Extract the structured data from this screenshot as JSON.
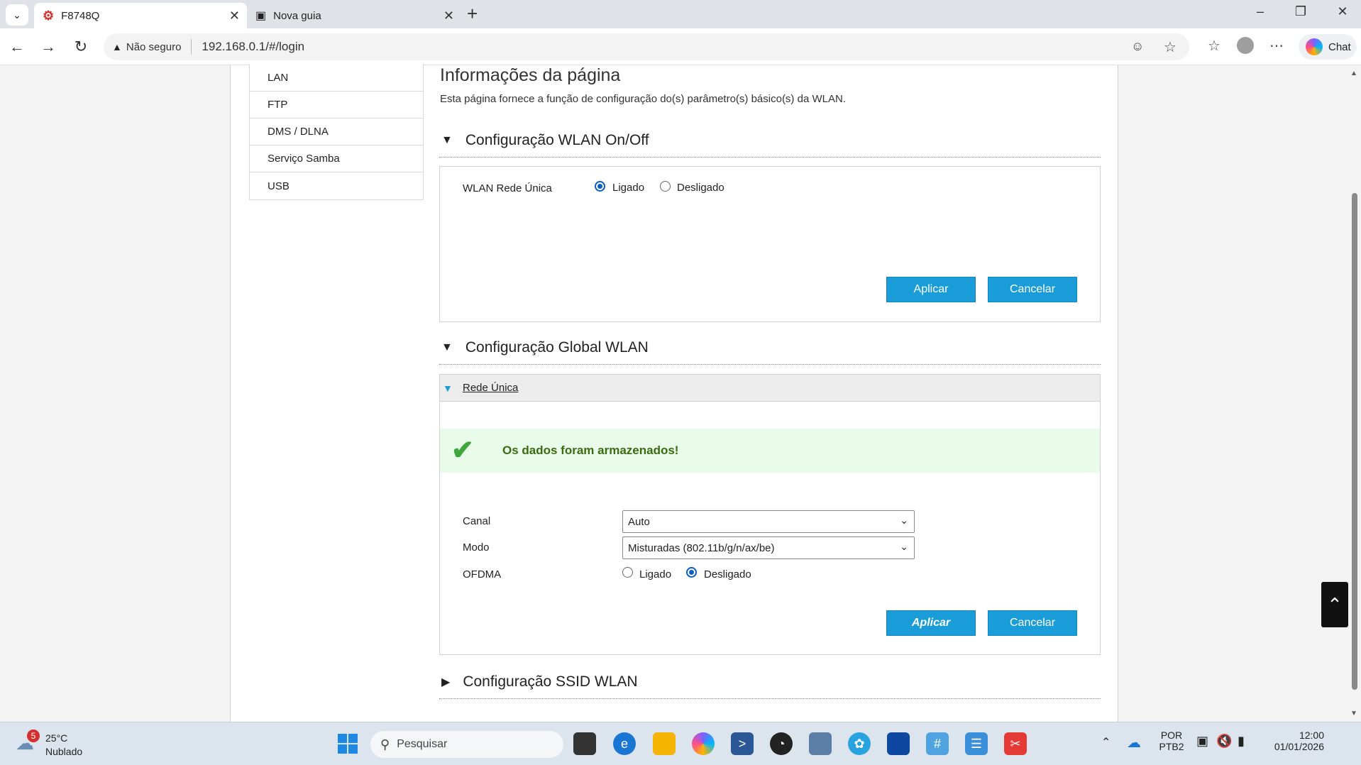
{
  "browser": {
    "tabs": [
      {
        "title": "F8748Q",
        "active": true
      },
      {
        "title": "Nova guia",
        "active": false
      }
    ],
    "new_tab": "+",
    "security_label": "Não seguro",
    "url": "192.168.0.1/#/login",
    "chat_label": "Chat"
  },
  "sidebar": {
    "items": [
      "LAN",
      "FTP",
      "DMS / DLNA",
      "Serviço Samba",
      "USB"
    ]
  },
  "main": {
    "title": "Informações da página",
    "description": "Esta página fornece a função de configuração do(s) parâmetro(s) básico(s) da WLAN.",
    "section_onoff": {
      "title": "Configuração WLAN On/Off",
      "field_label": "WLAN Rede Única",
      "option_on": "Ligado",
      "option_off": "Desligado",
      "selected": "Ligado",
      "apply": "Aplicar",
      "cancel": "Cancelar"
    },
    "section_global": {
      "title": "Configuração Global WLAN",
      "sub_title": "Rede Única",
      "success_message": "Os dados foram armazenados!",
      "canal_label": "Canal",
      "canal_value": "Auto",
      "modo_label": "Modo",
      "modo_value": "Misturadas (802.11b/g/n/ax/be)",
      "ofdma_label": "OFDMA",
      "ofdma_on": "Ligado",
      "ofdma_off": "Desligado",
      "ofdma_selected": "Desligado",
      "apply": "Aplicar",
      "cancel": "Cancelar"
    },
    "section_ssid": {
      "title": "Configuração SSID WLAN"
    }
  },
  "taskbar": {
    "weather_temp": "25°C",
    "weather_desc": "Nublado",
    "weather_badge": "5",
    "search_placeholder": "Pesquisar",
    "lang_top": "POR",
    "lang_bottom": "PTB2",
    "time": "12:00",
    "date": "01/01/2026"
  },
  "colors": {
    "button_blue": "#1a9cd8",
    "radio_blue": "#0a5dc2",
    "success_bg": "#e9fbe9",
    "success_text": "#3a6b12"
  }
}
